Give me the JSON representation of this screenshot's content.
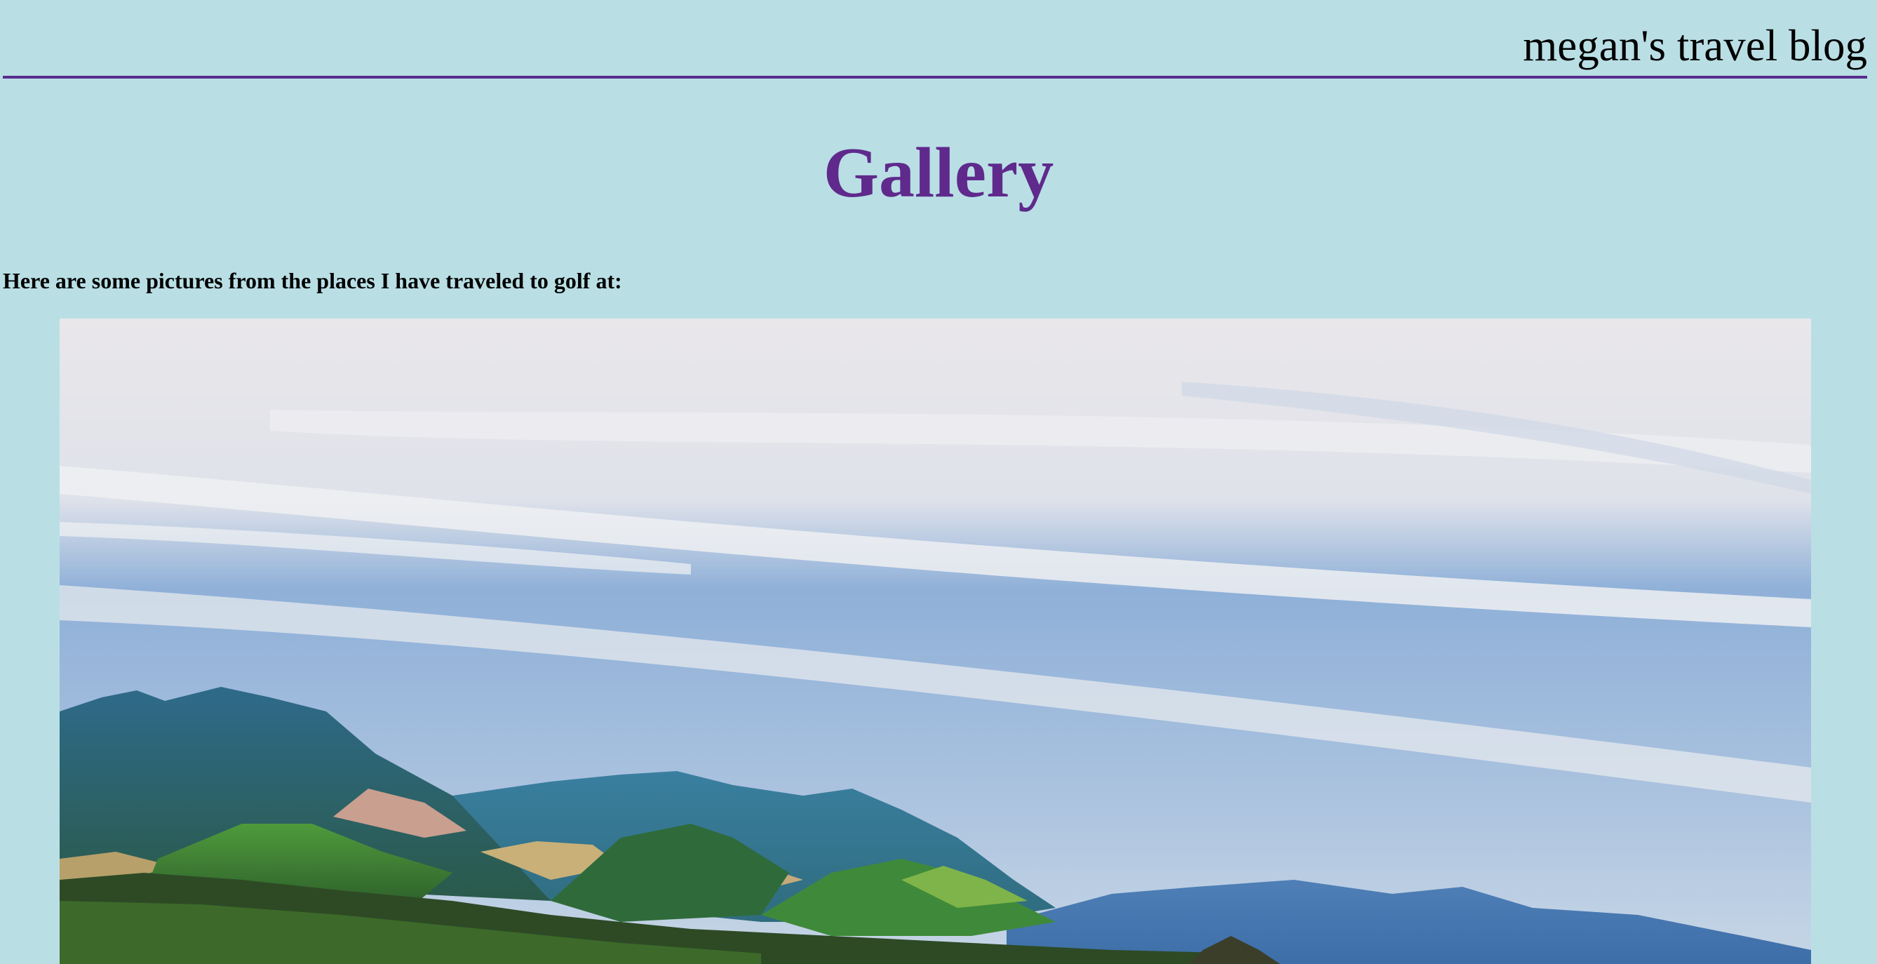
{
  "header": {
    "site_title": "megan's travel blog"
  },
  "main": {
    "page_title": "Gallery",
    "intro_text": "Here are some pictures from the places I have traveled to golf at:"
  },
  "gallery": {
    "photos": [
      {
        "subject": "mountain landscape under a cloudy blue sky"
      }
    ]
  },
  "colors": {
    "page_background": "#b9dfe5",
    "accent_purple": "#5f2a8c",
    "header_rule": "#5a2d8c"
  }
}
